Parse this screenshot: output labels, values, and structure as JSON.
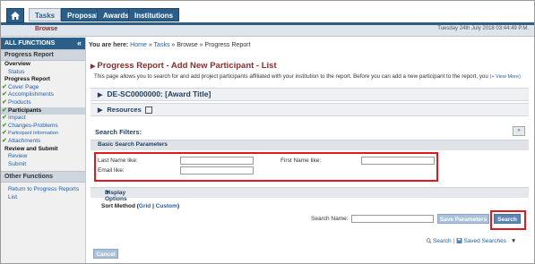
{
  "nav": {
    "home_icon": "home-icon",
    "tabs": [
      {
        "label": "Tasks",
        "active": true
      },
      {
        "label": "Proposals",
        "active": false
      },
      {
        "label": "Awards",
        "active": false
      },
      {
        "label": "Institutions",
        "active": false
      }
    ],
    "sub_label": "Browse",
    "datetime": "Tuesday 24th July 2018 03:44:49 P.M."
  },
  "sidebar": {
    "header": "ALL FUNCTIONS",
    "collapse_icon": "double-chevron-left-icon",
    "section1": "Progress Report",
    "items": [
      {
        "label": "Overview",
        "style": "bold"
      },
      {
        "label": "Status",
        "style": "link"
      },
      {
        "label": "Progress Report",
        "style": "bold"
      },
      {
        "label": "Cover Page",
        "style": "check"
      },
      {
        "label": "Accomplishments",
        "style": "check"
      },
      {
        "label": "Products",
        "style": "check"
      },
      {
        "label": "Participants",
        "style": "selected"
      },
      {
        "label": "Impact",
        "style": "check"
      },
      {
        "label": "Changes-Problems",
        "style": "check"
      },
      {
        "label": "Participant Information",
        "style": "check-small"
      },
      {
        "label": "Attachments",
        "style": "check"
      },
      {
        "label": "Review and Submit",
        "style": "bold"
      },
      {
        "label": "Review",
        "style": "link"
      },
      {
        "label": "Submit",
        "style": "link"
      }
    ],
    "section2": "Other Functions",
    "other_link_line1": "Return to Progress Reports",
    "other_link_line2": "List"
  },
  "breadcrumb": {
    "prefix": "You are here:",
    "home": "Home",
    "sep": "»",
    "tasks": "Tasks",
    "browse": "Browse",
    "current": "Progress Report"
  },
  "main": {
    "title": "Progress Report - Add New Participant - List",
    "description": "This page allows you to search for and add project participants affiliated with your institution to the report. Before you can add a new participant to the report, you",
    "view_more": "(+ View More)",
    "award_header": "DE-SC0000000: [Award Title]",
    "resources": "Resources",
    "search_filters": "Search Filters:",
    "basic_params": "Basic Search Parameters",
    "last_name_label": "Last Name like:",
    "first_name_label": "First Name like:",
    "email_label": "Email like:",
    "display_options": "Display Options",
    "sort_method_label": "Sort Method",
    "sort_grid": "Grid",
    "sort_sep": "|",
    "sort_custom": "Custom",
    "search_name_label": "Search Name:",
    "save_params_btn": "Save Parameters",
    "search_btn": "Search",
    "search_link": "Search",
    "saved_searches": "Saved Searches",
    "cancel_btn": "Cancel"
  },
  "colors": {
    "nav_blue": "#2b5f8a",
    "title_red": "#8a2b2b",
    "highlight_red": "#e0191e",
    "link_blue": "#1f5faa"
  }
}
